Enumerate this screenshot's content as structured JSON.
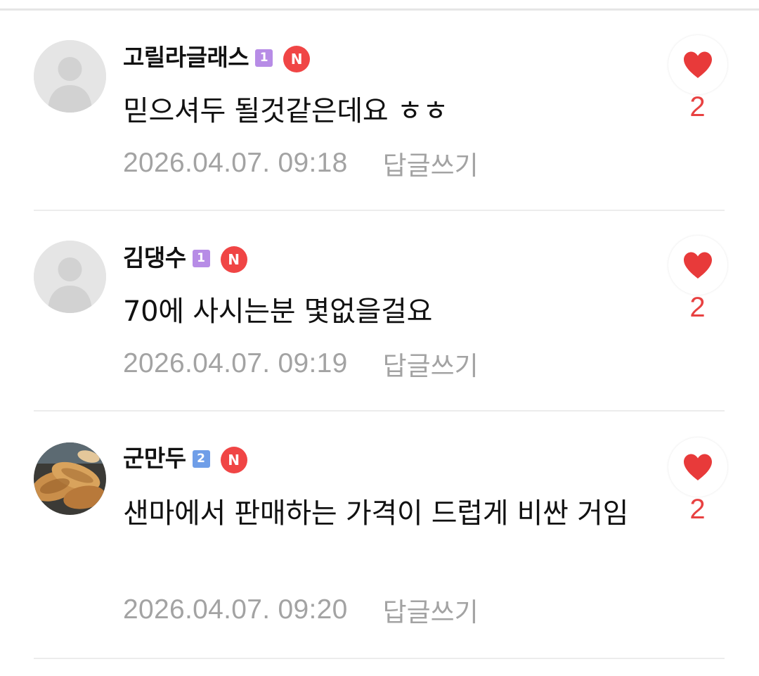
{
  "comments": [
    {
      "author": "고릴라글래스",
      "level": "1",
      "new_badge": "N",
      "text": "믿으셔두 될것같은데요 ㅎㅎ",
      "timestamp": "2026.04.07. 09:18",
      "reply_label": "답글쓰기",
      "likes": "2",
      "avatar": "default-profile-icon"
    },
    {
      "author": "김댕수",
      "level": "1",
      "new_badge": "N",
      "text": "70에 사시는분 몇없을걸요",
      "timestamp": "2026.04.07. 09:19",
      "reply_label": "답글쓰기",
      "likes": "2",
      "avatar": "default-profile-icon"
    },
    {
      "author": "군만두",
      "level": "2",
      "new_badge": "N",
      "text": "샌마에서 판매하는 가격이 드럽게 비싼 거임",
      "timestamp": "2026.04.07. 09:20",
      "reply_label": "답글쓰기",
      "likes": "2",
      "avatar": "dumpling-photo"
    }
  ],
  "colors": {
    "like_red": "#e84141",
    "new_badge_red": "#f04545",
    "level1_purple": "#b78ce6",
    "level2_blue": "#6f9ee8",
    "meta_gray": "#a3a3a3"
  }
}
